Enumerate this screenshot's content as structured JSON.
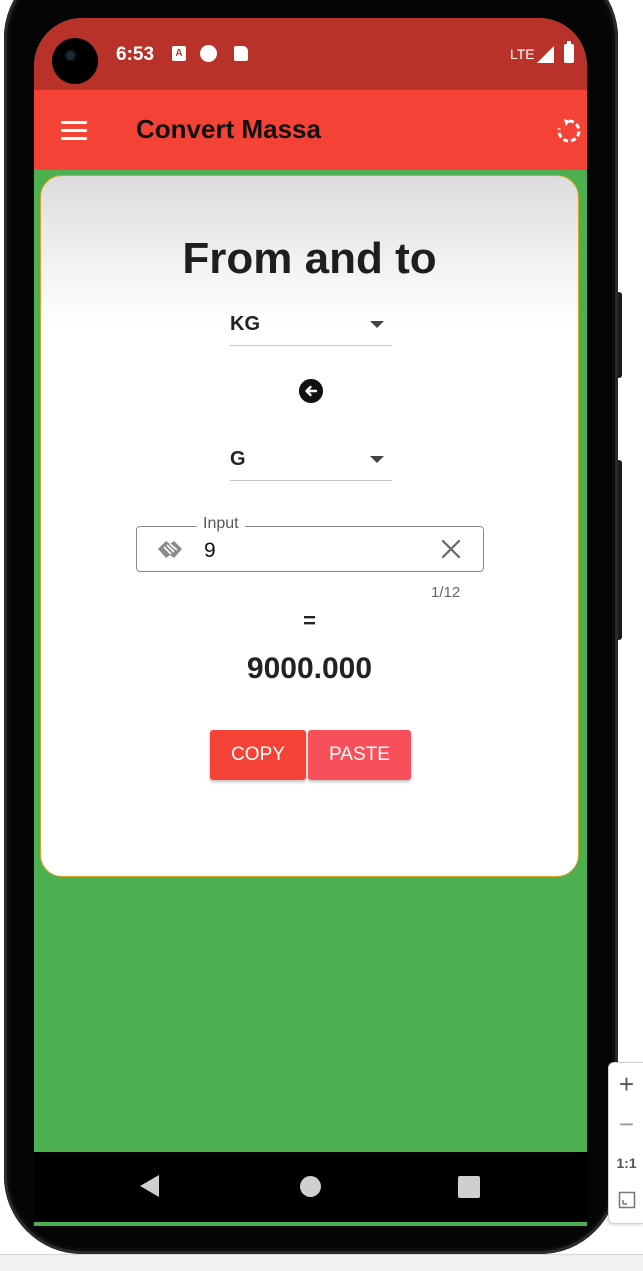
{
  "status_bar": {
    "time": "6:53",
    "network": "LTE"
  },
  "app_bar": {
    "title": "Convert Massa"
  },
  "card": {
    "title": "From and to",
    "from_unit": "KG",
    "to_unit": "G",
    "input": {
      "label": "Input",
      "value": "9",
      "counter": "1/12"
    },
    "equals": "=",
    "result": "9000.000",
    "copy_label": "COPY",
    "paste_label": "PASTE"
  },
  "zoom_controls": {
    "plus": "+",
    "minus": "−",
    "ratio": "1:1"
  },
  "colors": {
    "status_bar": "#b8322a",
    "app_bar": "#f44336",
    "background": "#4caf50",
    "card_border": "#e0a020",
    "copy_button": "#f44336",
    "paste_button": "#f7505a"
  },
  "icons": {
    "menu": "hamburger-menu-icon",
    "refresh": "refresh-icon",
    "swap": "arrow-left-circle-icon",
    "input_prefix": "handshake-icon",
    "clear": "close-icon"
  }
}
